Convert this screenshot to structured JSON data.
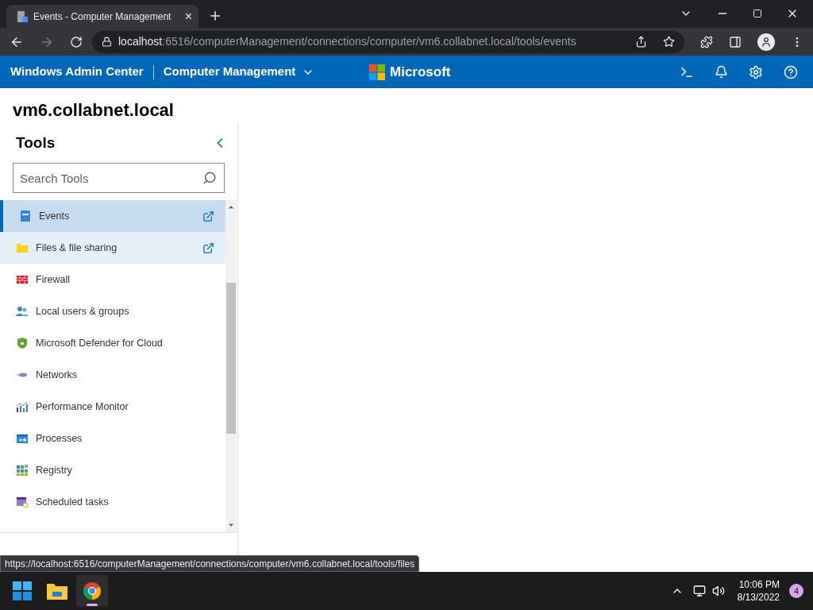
{
  "browser": {
    "tab": {
      "title": "Events - Computer Management",
      "close": "×"
    },
    "address": {
      "host": "localhost",
      "path": ":6516/computerManagement/connections/computer/vm6.collabnet.local/tools/events"
    }
  },
  "header": {
    "product": "Windows Admin Center",
    "tool": "Computer Management",
    "brand": "Microsoft"
  },
  "page_title": "vm6.collabnet.local",
  "tools": {
    "title": "Tools",
    "search": {
      "placeholder": "Search Tools"
    },
    "items": [
      {
        "label": "Events",
        "selected": true,
        "launch_icon": true
      },
      {
        "label": "Files & file sharing",
        "selected": false,
        "hovered": true,
        "launch_icon": true
      },
      {
        "label": "Firewall",
        "selected": false,
        "launch_icon": false
      },
      {
        "label": "Local users & groups",
        "selected": false,
        "launch_icon": false
      },
      {
        "label": "Microsoft Defender for Cloud",
        "selected": false,
        "launch_icon": false
      },
      {
        "label": "Networks",
        "selected": false,
        "launch_icon": false
      },
      {
        "label": "Performance Monitor",
        "selected": false,
        "launch_icon": false
      },
      {
        "label": "Processes",
        "selected": false,
        "launch_icon": false
      },
      {
        "label": "Registry",
        "selected": false,
        "launch_icon": false
      },
      {
        "label": "Scheduled tasks",
        "selected": false,
        "launch_icon": false
      }
    ]
  },
  "status_link": "https://localhost:6516/computerManagement/connections/computer/vm6.collabnet.local/tools/files",
  "taskbar": {
    "apps": [
      {
        "selected": false
      },
      {
        "selected": false
      },
      {
        "selected": true
      }
    ],
    "time": "10:06 PM",
    "date": "8/13/2022",
    "notifications": "4"
  }
}
